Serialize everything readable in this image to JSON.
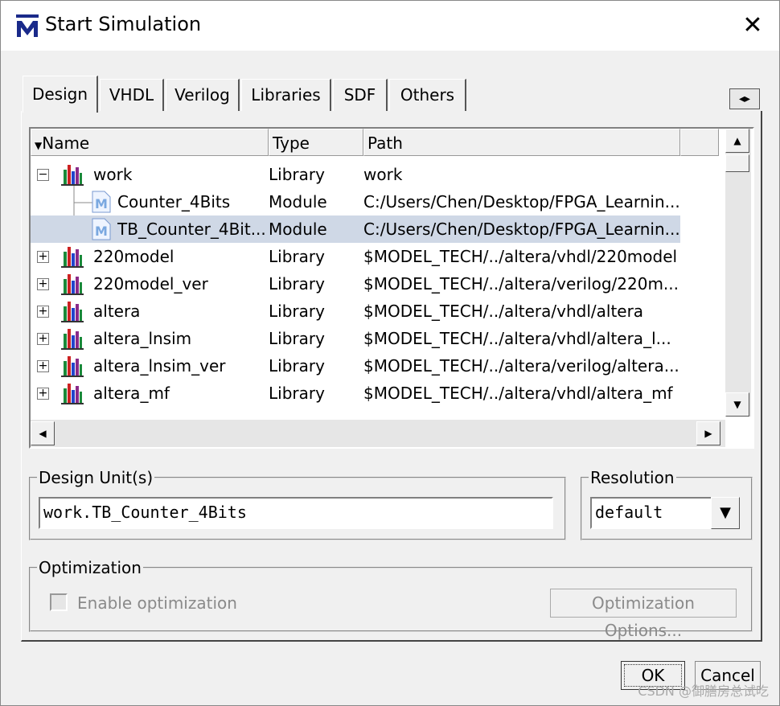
{
  "window": {
    "title": "Start Simulation",
    "close_glyph": "✕"
  },
  "tabs": [
    {
      "label": "Design",
      "active": true
    },
    {
      "label": "VHDL"
    },
    {
      "label": "Verilog"
    },
    {
      "label": "Libraries"
    },
    {
      "label": "SDF"
    },
    {
      "label": "Others"
    }
  ],
  "tab_scroll": {
    "left": "◂",
    "right": "▸"
  },
  "library_list": {
    "columns": {
      "name": "Name",
      "type": "Type",
      "path": "Path"
    },
    "rows": [
      {
        "name": "work",
        "type": "Library",
        "path": "work",
        "expander": "−",
        "icon": "library-icon",
        "level": 0
      },
      {
        "name": "Counter_4Bits",
        "type": "Module",
        "path": "C:/Users/Chen/Desktop/FPGA_Learnin...",
        "icon": "module-icon",
        "level": 1
      },
      {
        "name": "TB_Counter_4Bit...",
        "type": "Module",
        "path": "C:/Users/Chen/Desktop/FPGA_Learnin...",
        "icon": "module-icon",
        "level": 1,
        "selected": true
      },
      {
        "name": "220model",
        "type": "Library",
        "path": "$MODEL_TECH/../altera/vhdl/220model",
        "expander": "+",
        "icon": "library-icon",
        "level": 0
      },
      {
        "name": "220model_ver",
        "type": "Library",
        "path": "$MODEL_TECH/../altera/verilog/220m...",
        "expander": "+",
        "icon": "library-icon",
        "level": 0
      },
      {
        "name": "altera",
        "type": "Library",
        "path": "$MODEL_TECH/../altera/vhdl/altera",
        "expander": "+",
        "icon": "library-icon",
        "level": 0
      },
      {
        "name": "altera_lnsim",
        "type": "Library",
        "path": "$MODEL_TECH/../altera/vhdl/altera_l...",
        "expander": "+",
        "icon": "library-icon",
        "level": 0
      },
      {
        "name": "altera_lnsim_ver",
        "type": "Library",
        "path": "$MODEL_TECH/../altera/verilog/altera...",
        "expander": "+",
        "icon": "library-icon",
        "level": 0
      },
      {
        "name": "altera_mf",
        "type": "Library",
        "path": "$MODEL_TECH/../altera/vhdl/altera_mf",
        "expander": "+",
        "icon": "library-icon",
        "level": 0
      }
    ]
  },
  "design_units": {
    "legend": "Design Unit(s)",
    "value": "work.TB_Counter_4Bits"
  },
  "resolution": {
    "legend": "Resolution",
    "value": "default"
  },
  "optimization": {
    "legend": "Optimization",
    "checkbox_label": "Enable optimization",
    "options_button": "Optimization Options..."
  },
  "footer": {
    "ok": "OK",
    "cancel": "Cancel"
  },
  "watermark": "CSDN @御膳房总试吃",
  "colors": {
    "selection": "#cfd8e6",
    "title_icon": "#1a2a8a"
  }
}
